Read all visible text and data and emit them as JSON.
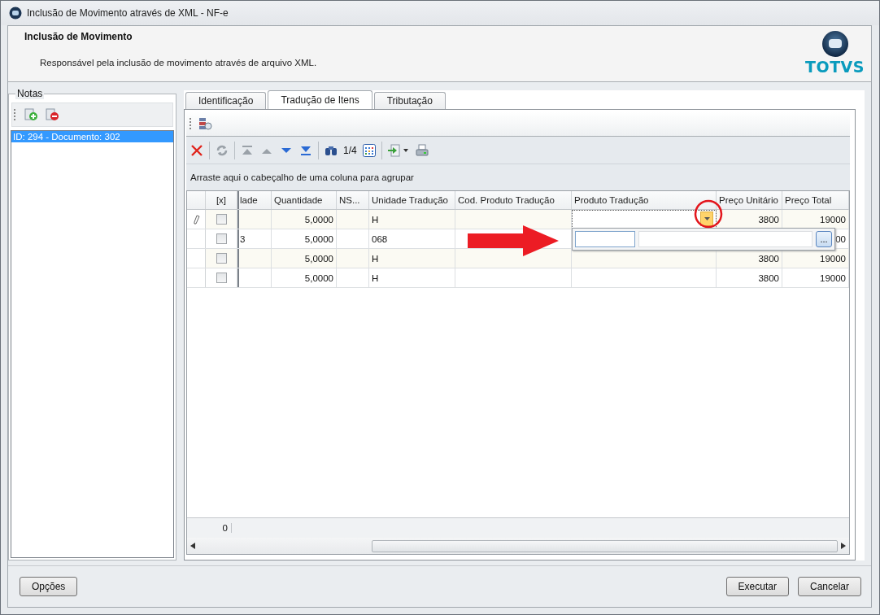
{
  "window": {
    "title": "Inclusão de Movimento através de XML - NF-e"
  },
  "header": {
    "title": "Inclusão de Movimento",
    "description": "Responsável pela inclusão de movimento através de arquivo XML.",
    "logo_text": "TOTVS"
  },
  "notes_panel": {
    "title": "Notas",
    "items": [
      {
        "label": "ID: 294 - Documento: 302",
        "selected": true
      }
    ]
  },
  "tabs": [
    {
      "label": "Identificação",
      "selected": false
    },
    {
      "label": "Tradução de Itens",
      "selected": true
    },
    {
      "label": "Tributação",
      "selected": false
    }
  ],
  "pager": "1/4",
  "group_hint": "Arraste aqui o cabeçalho de uma coluna para agrupar",
  "table": {
    "checkbox_header": "[x]",
    "columns": [
      "lade",
      "Quantidade",
      "NS...",
      "Unidade Tradução",
      "Cod. Produto Tradução",
      "Produto Tradução",
      "Preço Unitário",
      "Preço Total"
    ],
    "rows": [
      {
        "editing": true,
        "checked": false,
        "cells": [
          "",
          "5,0000",
          "",
          "H",
          "",
          "",
          "3800",
          "19000"
        ]
      },
      {
        "editing": false,
        "checked": false,
        "cells": [
          "3",
          "5,0000",
          "",
          "068",
          "",
          "",
          "",
          "00"
        ]
      },
      {
        "editing": false,
        "checked": false,
        "cells": [
          "",
          "5,0000",
          "",
          "H",
          "",
          "",
          "3800",
          "19000"
        ]
      },
      {
        "editing": false,
        "checked": false,
        "cells": [
          "",
          "5,0000",
          "",
          "H",
          "",
          "",
          "3800",
          "19000"
        ]
      }
    ]
  },
  "lookup_popup": {
    "browse_button": "..."
  },
  "footer_count": "0",
  "annotations": {
    "arrow": true,
    "dropdown_circled": true
  },
  "footer": {
    "left_buttons": [
      "Opções"
    ],
    "right_buttons": [
      "Executar",
      "Cancelar"
    ]
  }
}
